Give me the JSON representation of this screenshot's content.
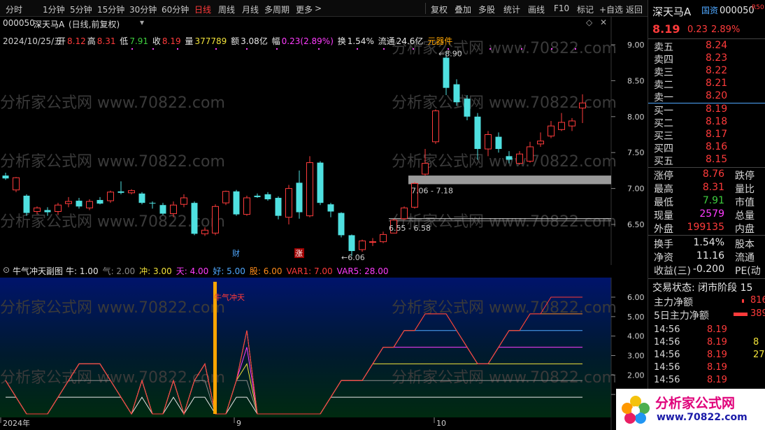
{
  "toolbar": {
    "periods": [
      "分时",
      "1分钟",
      "5分钟",
      "15分钟",
      "30分钟",
      "60分钟",
      "日线",
      "周线",
      "月线",
      "多周期",
      "更多"
    ],
    "active_period": "日线",
    "more_arrow": ">",
    "tools": [
      "复权",
      "叠加",
      "多股",
      "统计",
      "画线",
      "F10",
      "标记",
      "+自选",
      "返回"
    ]
  },
  "title": {
    "code": "000050",
    "name": "深天马A",
    "mode": "(日线,前复权)",
    "dropdown": "▾"
  },
  "info": {
    "date": "2024/10/25/五",
    "open_label": "开",
    "open": "8.12",
    "high_label": "高",
    "high": "8.31",
    "low_label": "低",
    "low": "7.91",
    "close_label": "收",
    "close": "8.19",
    "vol_label": "量",
    "vol": "377789",
    "amt_label": "额",
    "amt": "3.08亿",
    "chg_label": "幅",
    "chg": "0.23(2.89%)",
    "turn_label": "换",
    "turn": "1.54%",
    "float_label": "流通",
    "float": "24.6亿",
    "sector": "元器件"
  },
  "watermark": "分析家公式网 www.70822.com",
  "chart_data": [
    {
      "type": "candlestick",
      "title": "",
      "y_ticks": [
        "9.00",
        "8.50",
        "8.00",
        "7.50",
        "7.00",
        "6.50"
      ],
      "ylim": [
        6.0,
        9.2
      ],
      "annotations": [
        "8.90",
        "7.06 - 7.18",
        "6.55 - 6.58",
        "6.06"
      ],
      "markers": [
        "财",
        "涨"
      ],
      "candles": [
        {
          "o": 7.18,
          "c": 7.14,
          "h": 7.22,
          "l": 7.12
        },
        {
          "o": 6.98,
          "c": 7.15,
          "h": 7.16,
          "l": 6.95
        },
        {
          "o": 6.9,
          "c": 6.66,
          "h": 6.92,
          "l": 6.62
        },
        {
          "o": 6.68,
          "c": 6.73,
          "h": 6.75,
          "l": 6.64
        },
        {
          "o": 6.7,
          "c": 6.67,
          "h": 6.74,
          "l": 6.62
        },
        {
          "o": 6.68,
          "c": 6.77,
          "h": 6.8,
          "l": 6.63
        },
        {
          "o": 6.79,
          "c": 6.82,
          "h": 6.88,
          "l": 6.74
        },
        {
          "o": 6.83,
          "c": 6.75,
          "h": 6.87,
          "l": 6.72
        },
        {
          "o": 6.73,
          "c": 6.82,
          "h": 6.85,
          "l": 6.7
        },
        {
          "o": 6.84,
          "c": 6.79,
          "h": 6.88,
          "l": 6.78
        },
        {
          "o": 6.83,
          "c": 6.95,
          "h": 6.97,
          "l": 6.8
        },
        {
          "o": 6.96,
          "c": 6.94,
          "h": 7.1,
          "l": 6.92
        },
        {
          "o": 6.94,
          "c": 6.97,
          "h": 6.99,
          "l": 6.92
        },
        {
          "o": 6.93,
          "c": 6.8,
          "h": 6.95,
          "l": 6.78
        },
        {
          "o": 6.8,
          "c": 6.79,
          "h": 6.82,
          "l": 6.72
        },
        {
          "o": 6.77,
          "c": 6.65,
          "h": 6.8,
          "l": 6.63
        },
        {
          "o": 6.65,
          "c": 6.77,
          "h": 6.82,
          "l": 6.6
        },
        {
          "o": 6.78,
          "c": 6.87,
          "h": 6.92,
          "l": 6.74
        },
        {
          "o": 6.8,
          "c": 6.37,
          "h": 6.82,
          "l": 6.35
        },
        {
          "o": 6.37,
          "c": 6.42,
          "h": 6.46,
          "l": 6.34
        },
        {
          "o": 6.38,
          "c": 6.75,
          "h": 6.78,
          "l": 6.35
        },
        {
          "o": 6.8,
          "c": 6.96,
          "h": 6.97,
          "l": 6.77
        },
        {
          "o": 6.96,
          "c": 6.64,
          "h": 6.98,
          "l": 6.62
        },
        {
          "o": 6.64,
          "c": 6.87,
          "h": 6.9,
          "l": 6.62
        },
        {
          "o": 6.9,
          "c": 6.88,
          "h": 6.93,
          "l": 6.87
        },
        {
          "o": 6.92,
          "c": 6.85,
          "h": 6.95,
          "l": 6.83
        },
        {
          "o": 6.87,
          "c": 6.62,
          "h": 6.89,
          "l": 6.57
        },
        {
          "o": 6.6,
          "c": 7.0,
          "h": 7.05,
          "l": 6.5
        },
        {
          "o": 7.08,
          "c": 6.67,
          "h": 7.25,
          "l": 6.58
        },
        {
          "o": 6.62,
          "c": 7.36,
          "h": 7.45,
          "l": 6.6
        },
        {
          "o": 7.36,
          "c": 6.8,
          "h": 7.38,
          "l": 6.77
        },
        {
          "o": 6.78,
          "c": 6.68,
          "h": 6.8,
          "l": 6.6
        },
        {
          "o": 6.66,
          "c": 6.35,
          "h": 6.67,
          "l": 6.32
        },
        {
          "o": 6.35,
          "c": 6.13,
          "h": 6.36,
          "l": 6.06
        },
        {
          "o": 6.15,
          "c": 6.27,
          "h": 6.29,
          "l": 6.12
        },
        {
          "o": 6.26,
          "c": 6.26,
          "h": 6.31,
          "l": 6.2
        },
        {
          "o": 6.26,
          "c": 6.36,
          "h": 6.4,
          "l": 6.24
        },
        {
          "o": 6.38,
          "c": 6.56,
          "h": 6.58,
          "l": 6.38
        },
        {
          "o": 6.58,
          "c": 6.73,
          "h": 6.75,
          "l": 6.56
        },
        {
          "o": 6.74,
          "c": 7.07,
          "h": 7.09,
          "l": 6.72
        },
        {
          "o": 7.2,
          "c": 7.35,
          "h": 7.55,
          "l": 7.18
        },
        {
          "o": 7.65,
          "c": 8.08,
          "h": 8.1,
          "l": 7.62
        },
        {
          "o": 8.82,
          "c": 8.4,
          "h": 8.9,
          "l": 8.3
        },
        {
          "o": 8.45,
          "c": 8.2,
          "h": 8.52,
          "l": 8.15
        },
        {
          "o": 8.25,
          "c": 8.0,
          "h": 8.3,
          "l": 7.95
        },
        {
          "o": 8.0,
          "c": 7.55,
          "h": 8.05,
          "l": 7.4
        },
        {
          "o": 7.55,
          "c": 7.75,
          "h": 7.8,
          "l": 7.45
        },
        {
          "o": 7.72,
          "c": 7.55,
          "h": 7.78,
          "l": 7.5
        },
        {
          "o": 7.45,
          "c": 7.4,
          "h": 7.52,
          "l": 7.35
        },
        {
          "o": 7.35,
          "c": 7.48,
          "h": 7.52,
          "l": 7.33
        },
        {
          "o": 7.38,
          "c": 7.58,
          "h": 7.65,
          "l": 7.36
        },
        {
          "o": 7.62,
          "c": 7.66,
          "h": 7.78,
          "l": 7.58
        },
        {
          "o": 7.73,
          "c": 7.87,
          "h": 7.94,
          "l": 7.7
        },
        {
          "o": 7.82,
          "c": 7.92,
          "h": 8.05,
          "l": 7.8
        },
        {
          "o": 7.87,
          "c": 7.94,
          "h": 7.98,
          "l": 7.8
        },
        {
          "o": 8.12,
          "c": 8.19,
          "h": 8.31,
          "l": 7.91
        }
      ]
    },
    {
      "type": "line",
      "title": "牛气冲天副图",
      "series_labels": [
        {
          "name": "牛",
          "value": "1.00",
          "color": "#e8e8e8"
        },
        {
          "name": "气",
          "value": "2.00",
          "color": "#8a8a8a"
        },
        {
          "name": "冲",
          "value": "3.00",
          "color": "#f2e33a"
        },
        {
          "name": "天",
          "value": "4.00",
          "color": "#ff3cff"
        },
        {
          "name": "好",
          "value": "5.00",
          "color": "#4fa8ff"
        },
        {
          "name": "股",
          "value": "6.00",
          "color": "#ff8c1a"
        },
        {
          "name": "VAR1",
          "value": "7.00",
          "color": "#ff3b3b"
        },
        {
          "name": "VAR5",
          "value": "28.00",
          "color": "#ff3cff"
        }
      ],
      "y_ticks": [
        "6.00",
        "5.00",
        "4.00",
        "3.00",
        "2.00",
        "1.00"
      ],
      "ylim": [
        0,
        7
      ],
      "signal_label": "牛气冲天",
      "x_labels": [
        "2024年",
        "9",
        "10"
      ],
      "levels": [
        2,
        1,
        0,
        0,
        0,
        1,
        2,
        3,
        3,
        3,
        2,
        1,
        0,
        2,
        0,
        0,
        2,
        0,
        2,
        3,
        0,
        0,
        2,
        5,
        0,
        0,
        0,
        0,
        0,
        0,
        0,
        1,
        2,
        2,
        2,
        3,
        4,
        4,
        5,
        5,
        6,
        6,
        6,
        5,
        4,
        3,
        3,
        4,
        5,
        5,
        6,
        6,
        7,
        7,
        7,
        7
      ]
    }
  ],
  "right_panel": {
    "name": "深天马A",
    "tag": "国资",
    "code": "000050",
    "r_tag": "R",
    "r_num": "50",
    "price": "8.19",
    "change": "0.23",
    "change_pct": "2.89%",
    "asks": [
      {
        "label": "卖五",
        "price": "8.24"
      },
      {
        "label": "卖四",
        "price": "8.23"
      },
      {
        "label": "卖三",
        "price": "8.22"
      },
      {
        "label": "卖二",
        "price": "8.21"
      },
      {
        "label": "卖一",
        "price": "8.20"
      }
    ],
    "bids": [
      {
        "label": "买一",
        "price": "8.19"
      },
      {
        "label": "买二",
        "price": "8.18"
      },
      {
        "label": "买三",
        "price": "8.17"
      },
      {
        "label": "买四",
        "price": "8.16"
      },
      {
        "label": "买五",
        "price": "8.15"
      }
    ],
    "stats": [
      {
        "label": "涨停",
        "value": "8.76",
        "color": "#ff3b3b",
        "right": "跌停"
      },
      {
        "label": "最高",
        "value": "8.31",
        "color": "#ff3b3b",
        "right": "量比"
      },
      {
        "label": "最低",
        "value": "7.91",
        "color": "#3fce3f",
        "right": "市值"
      },
      {
        "label": "现量",
        "value": "2579",
        "color": "#ff3cff",
        "right": "总量"
      },
      {
        "label": "外盘",
        "value": "199135",
        "color": "#ff3b3b",
        "right": "内盘"
      }
    ],
    "stats2": [
      {
        "label": "换手",
        "value": "1.54%",
        "color": "#e8e8e8",
        "right": "股本"
      },
      {
        "label": "净资",
        "value": "11.16",
        "color": "#e8e8e8",
        "right": "流通"
      },
      {
        "label": "收益(三)",
        "value": "-0.200",
        "color": "#e8e8e8",
        "right": "PE(动"
      }
    ],
    "trade_status": "交易状态: 闭市阶段 15",
    "capital": [
      {
        "label": "主力净额",
        "value": "816"
      },
      {
        "label": "5日主力净额",
        "value": "389"
      }
    ],
    "ticks": [
      {
        "time": "14:56",
        "price": "8.19",
        "vol": ""
      },
      {
        "time": "14:56",
        "price": "8.19",
        "vol": "8"
      },
      {
        "time": "14:56",
        "price": "8.19",
        "vol": "27"
      },
      {
        "time": "14:56",
        "price": "8.19",
        "vol": ""
      },
      {
        "time": "14:56",
        "price": "8.19",
        "vol": ""
      }
    ],
    "logo_text": "分析家公式网",
    "logo_url": "www.70822.com"
  }
}
